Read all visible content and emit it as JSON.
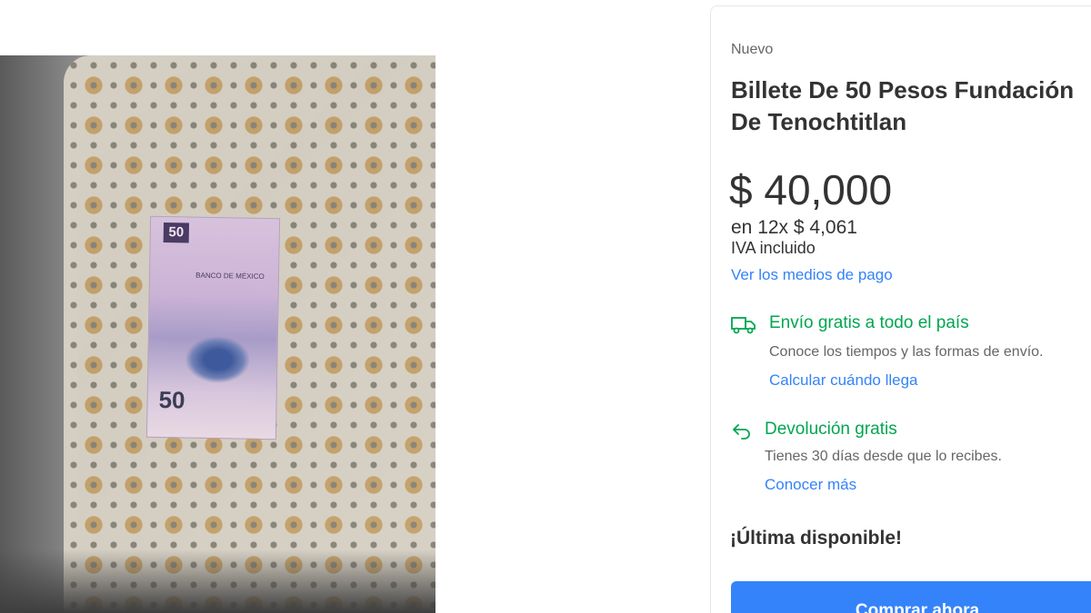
{
  "product_image": {
    "icon": "banknote-photo",
    "banknote": {
      "denomination_top": "50",
      "bank_text": "BANCO DE MÉXICO",
      "denomination_bottom": "50"
    }
  },
  "product": {
    "condition": "Nuevo",
    "title": "Billete De 50 Pesos Fundación De Tenochtitlan",
    "price": "$ 40,000",
    "installments": "en 12x $ 4,061",
    "tax_note": "IVA incluido",
    "payment_link": "Ver los medios de pago"
  },
  "shipping": {
    "icon": "truck-icon",
    "title": "Envío gratis a todo el país",
    "subtitle": "Conoce los tiempos y las formas de envío.",
    "link": "Calcular cuándo llega"
  },
  "returns": {
    "icon": "return-arrow-icon",
    "title": "Devolución gratis",
    "subtitle": "Tienes 30 días desde que lo recibes.",
    "link": "Conocer más"
  },
  "stock_text": "¡Última disponible!",
  "buy_button": "Comprar ahora",
  "colors": {
    "accent_blue": "#3483fa",
    "success_green": "#00a650",
    "text_dark": "#333333",
    "text_muted": "#666666"
  }
}
